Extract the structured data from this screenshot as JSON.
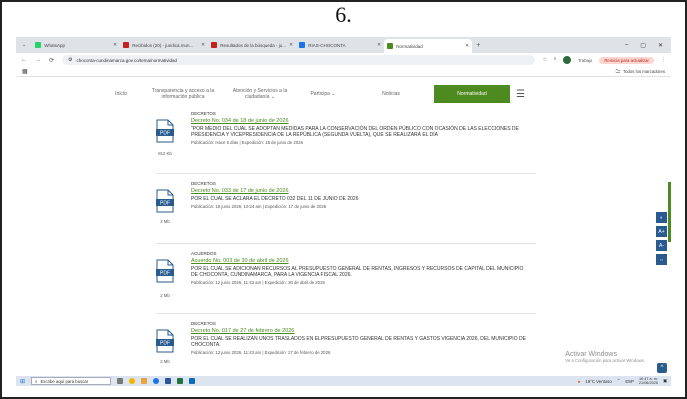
{
  "page_number": "6.",
  "browser": {
    "tabs": [
      {
        "label": "WhatsApp",
        "color": "#25d366",
        "active": false
      },
      {
        "label": "Recibidos (20) - juridica.mun...",
        "color": "#c5221f",
        "active": false
      },
      {
        "label": "Resultados de la búsqueda - ju...",
        "color": "#c5221f",
        "active": false
      },
      {
        "label": "RIAS-CHOCONTA",
        "color": "#1a73e8",
        "active": false
      },
      {
        "label": "Normatividad",
        "color": "#4d8a1f",
        "active": true
      }
    ],
    "new_tab": "+",
    "window_controls": [
      "–",
      "▢",
      "✕"
    ],
    "url": "choconta-cundinamarca.gov.co/tema/normatividad",
    "nav_buttons": [
      "←",
      "→",
      "⟳"
    ],
    "profile_label": "Trabajo",
    "update_label": "Reinicia para actualizar",
    "bookmarks_all": "Todos los marcadores"
  },
  "site": {
    "nav": [
      {
        "label": "Inicio",
        "active": false
      },
      {
        "label": "Transparencia y acceso a la información pública",
        "active": false
      },
      {
        "label": "Atención y Servicios a la ciudadanía ⌄",
        "active": false
      },
      {
        "label": "Participa ⌄",
        "active": false
      },
      {
        "label": "Noticias",
        "active": false
      },
      {
        "label": "Normatividad",
        "active": true
      }
    ],
    "menu_icon": "☰"
  },
  "entries": [
    {
      "category": "DECRETOS",
      "title": "Decreto No. 034 de 18 de junio de 2026",
      "description": "\"POR MEDIO DEL CUAL SE ADOPTAN MEDIDAS PARA LA CONSERVACIÓN DEL ORDEN PÚBLICO CON OCASIÓN DE LAS ELECCIONES DE PRESIDENCIA Y VICEPRESIDENCIA DE LA REPÚBLICA (SEGUNDA VUELTA), QUE SE REALIZARÁ EL DÍA",
      "meta": "Publicación: Hace 6 días | Expedición: 18 de junio de 2026",
      "size": "812 Kb"
    },
    {
      "category": "DECRETOS",
      "title": "Decreto No. 033 de 17 de junio de 2026",
      "description": "POR EL CUAL SE ACLARA EL DECRETO 032 DEL 11 DE JUNIO DE 2026",
      "meta": "Publicación: 18 junio 2026, 10:24 am | Expedición: 17 de junio de 2026",
      "size": "2 Mb"
    },
    {
      "category": "ACUERDOS",
      "title": "Acuerdo No. 003 de 30 de abril de 2026",
      "description": "POR EL CUAL SE ADICIONAN RECURSOS AL PRESUPUESTO GENERAL DE RENTAS, INGRESOS Y RECURSOS DE CAPITAL DEL MUNICIPIO DE CHOCONTA, CUNDINAMARCA, PARA LA VIGENCIA FISCAL 2026.",
      "meta": "Publicación: 12 junio 2026, 11:43 am | Expedición: 30 de abril de 2026",
      "size": "2 Mb"
    },
    {
      "category": "DECRETOS",
      "title": "Decreto No. 017 de 27 de febrero de 2026",
      "description": "POR EL CUAL SE REALIZAN UNOS TRASLADOS EN ELPRESUPUESTO GENERAL DE RENTAS Y GASTOS VIGENCIA 2026, DEL MUNICIPIO DE CHOCONTA.",
      "meta": "Publicación: 12 junio 2026, 11:43 am | Expedición: 27 de febrero de 2026",
      "size": "2 Mb"
    }
  ],
  "pdf_label": "PDF",
  "side_tools": [
    "◐",
    "A+",
    "A-",
    "⇔"
  ],
  "watermark": {
    "line1": "Activar Windows",
    "line2": "Ve a Configuración para activar Windows."
  },
  "taskbar": {
    "search_placeholder": "Escribe aquí para buscar",
    "weather": "19°C Ventoso",
    "lang": "ESP",
    "time": "10:47 a. m.",
    "date": "21/06/2026"
  }
}
